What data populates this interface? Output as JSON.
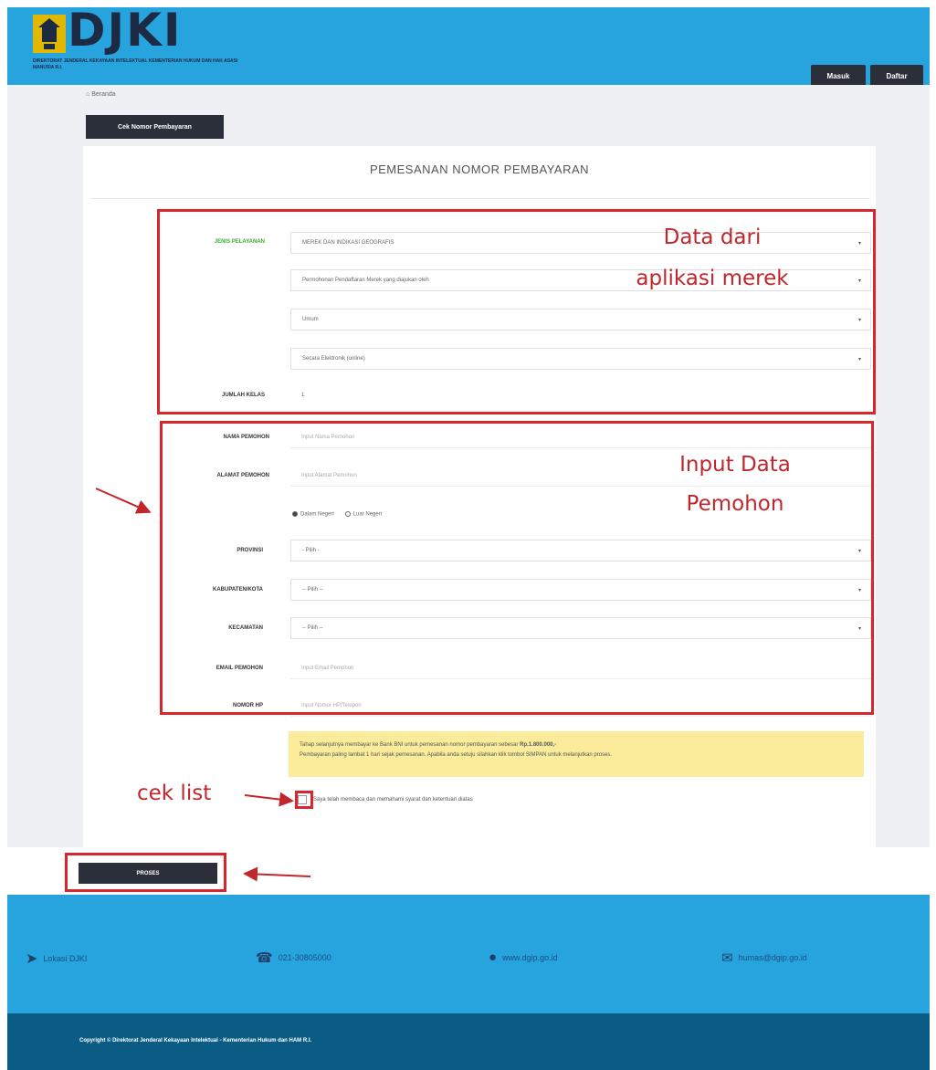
{
  "header": {
    "logo_text": "DJKI",
    "logo_subtitle": "DIREKTORAT JENDERAL KEKAYAAN INTELEKTUAL KEMENTERIAN HUKUM DAN HAK ASASI MANUSIA R.I.",
    "login_label": "Masuk",
    "register_label": "Daftar"
  },
  "breadcrumb": "Beranda",
  "cek_button": "Cek Nomor Pembayaran",
  "title": "PEMESANAN NOMOR PEMBAYARAN",
  "form": {
    "jenis_pelayanan_label": "JENIS PELAYANAN",
    "jenis_pelayanan_value": "MEREK DAN INDIKASI GEOGRAFIS",
    "select2_value": "Permohonan Pendaftaran Merek yang diajukan oleh",
    "select3_value": "Umum",
    "select4_value": "Secara Elektronik (online)",
    "jumlah_kelas_label": "JUMLAH KELAS",
    "jumlah_kelas_value": "1",
    "nama_label": "NAMA PEMOHON",
    "nama_placeholder": "Input Nama Pemohon",
    "alamat_label": "ALAMAT PEMOHON",
    "alamat_placeholder": "Input Alamat Pemohon",
    "radio_dalam": "Dalam Negeri",
    "radio_luar": "Luar Negeri",
    "provinsi_label": "PROVINSI",
    "provinsi_value": "- Pilih -",
    "kabupaten_label": "KABUPATEN/KOTA",
    "kabupaten_value": "-- Pilih --",
    "kecamatan_label": "KECAMATAN",
    "kecamatan_value": "-- Pilih --",
    "email_label": "EMAIL PEMOHON",
    "email_placeholder": "Input Email Pemohon",
    "nomor_hp_label": "NOMOR HP",
    "nomor_hp_placeholder": "Input Nomor HP/Telepon"
  },
  "notice": {
    "line1": "Tahap selanjutnya membayar ke Bank BNI untuk pemesanan nomor pembayaran sebesar",
    "amount": "Rp.1.800.000,-",
    "line2": "Pembayaran paling lambat 1 hari sejak pemesanan. Apabila anda setuju silahkan klik tombol SIMPAN untuk melanjutkan proses."
  },
  "agree_text": "Saya telah membaca dan memahami syarat dan ketentuan diatas",
  "proses_button": "PROSES",
  "annotations": {
    "data_dari": "Data dari",
    "aplikasi_merek": "aplikasi merek",
    "input_data": "Input Data",
    "pemohon": "Pemohon",
    "cek_list": "cek list"
  },
  "footer": {
    "location": "Lokasi DJKI",
    "phone": "021-30805000",
    "website": "www.dgip.go.id",
    "email": "humas@dgip.go.id",
    "copyright": "Copyright © Direktorat Jenderal Kekayaan Intelektual - Kementerian Hukum dan HAM R.I."
  },
  "colors": {
    "header_blue": "#27a3dd",
    "dark_button": "#2b2f3a",
    "annotation_red": "#d7262c",
    "notice_yellow": "#faec9a",
    "copyright_bg": "#0b5c85"
  }
}
